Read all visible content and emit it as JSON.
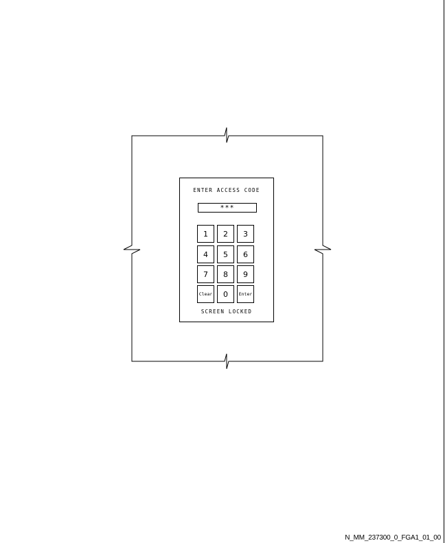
{
  "screen": {
    "title": "ENTER ACCESS CODE",
    "code_value": "***",
    "status": "SCREEN LOCKED"
  },
  "keypad": {
    "keys": [
      "1",
      "2",
      "3",
      "4",
      "5",
      "6",
      "7",
      "8",
      "9",
      "Clear",
      "0",
      "Enter"
    ]
  },
  "figure_id": "N_MM_237300_0_FGA1_01_00"
}
